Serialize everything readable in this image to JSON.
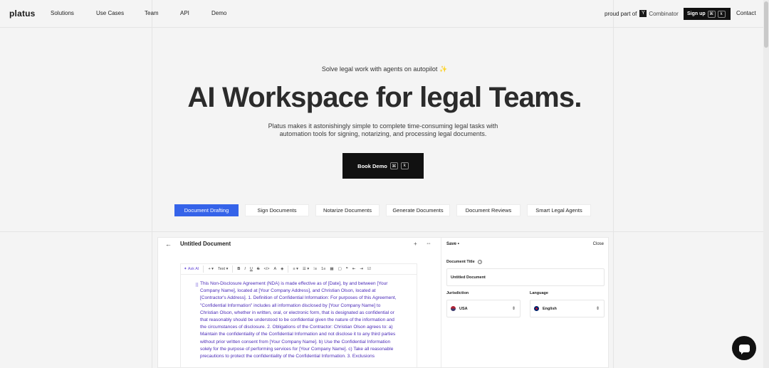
{
  "nav": {
    "logo": "platus",
    "links": [
      "Solutions",
      "Use Cases",
      "Team",
      "API",
      "Demo"
    ],
    "proud": "proud part of",
    "yc_letter": "Y",
    "yc_name": "Combinator",
    "signup": "Sign up",
    "signup_kbd": [
      "⌘",
      "k"
    ],
    "contact": "Contact"
  },
  "hero": {
    "tagline": "Solve legal work with agents on autopilot",
    "tagline_icon": "✨",
    "headline": "AI Workspace for legal Teams.",
    "subtitle": "Platus makes it astonishingly simple to complete time-consuming legal tasks with automation tools for signing, notarizing, and processing legal documents.",
    "cta": "Book Demo",
    "cta_kbd": [
      "⌘",
      "k"
    ]
  },
  "tabs": [
    "Document Drafting",
    "Sign Documents",
    "Notarize Documents",
    "Generate Documents",
    "Document Reviews",
    "Smart Legal Agents"
  ],
  "editor": {
    "back": "←",
    "title": "Untitled Document",
    "plus": "+",
    "link": "⇔",
    "toolbar": {
      "ask_ai": "✦ Ask AI",
      "insert": "+ ▾",
      "text": "Text ▾",
      "bold": "B",
      "italic": "I",
      "underline": "U",
      "strike": "S",
      "code": "</>",
      "color": "A",
      "highlight": "◈",
      "align": "≡ ▾",
      "list": "☰ ▾",
      "bullets": "⁝≡",
      "numbers": "1≡",
      "table": "▦",
      "image": "▢",
      "quote": "❝",
      "indent_left": "⇤",
      "indent_right": "⇥",
      "checklist": "☑"
    },
    "handle": "⠿",
    "body": "This Non-Disclosure Agreement (NDA) is made effective as of [Date], by and between [Your Company Name], located at [Your Company Address], and Christian Olson, located at [Contractor's Address]. 1. Definition of Confidential Information: For purposes of this Agreement, \"Confidential Information\" includes all information disclosed by [Your Company Name] to Christian Olson, whether in written, oral, or electronic form, that is designated as confidential or that reasonably should be understood to be confidential given the nature of the information and the circumstances of disclosure. 2. Obligations of the Contractor: Christian Olson agrees to: a) Maintain the confidentiality of the Confidential Information and not disclose it to any third parties without prior written consent from [Your Company Name]. b) Use the Confidential Information solely for the purpose of performing services for [Your Company Name]. c) Take all reasonable precautions to protect the confidentiality of the Confidential Information. 3. Exclusions"
  },
  "sidepanel": {
    "save": "Save",
    "save_dot": "•",
    "close": "Close",
    "doc_title_label": "Document Title",
    "info": "i",
    "doc_title_value": "Untitled Document",
    "jurisdiction_label": "Jurisdiction",
    "jurisdiction_value": "USA",
    "language_label": "Language",
    "language_value": "English",
    "caret": "⇕"
  },
  "colors": {
    "accent": "#3563e9",
    "editor_text": "#4b2bb8",
    "dark": "#111111"
  }
}
